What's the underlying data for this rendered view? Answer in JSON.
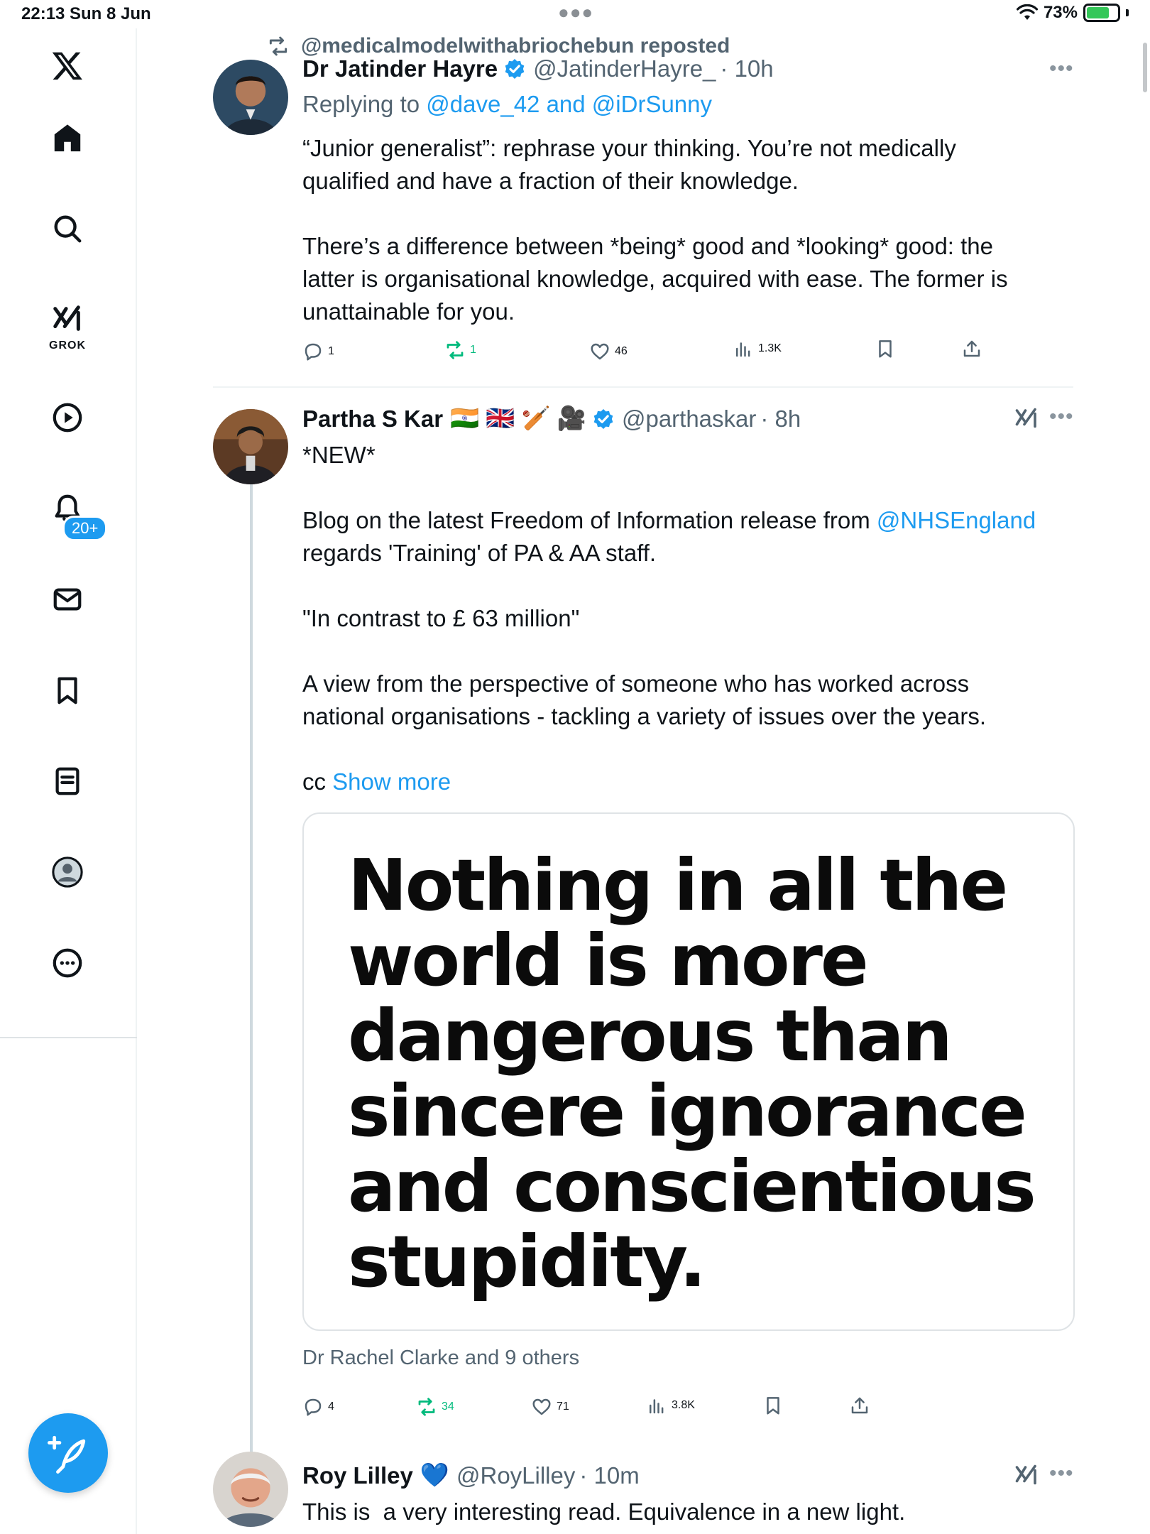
{
  "status_bar": {
    "time": "22:13",
    "date": "Sun 8 Jun",
    "battery": "73%",
    "battery_fraction": 0.73
  },
  "sidebar": {
    "items": [
      "x-logo",
      "home",
      "search",
      "grok",
      "videos",
      "notifications",
      "messages",
      "bookmarks",
      "lists",
      "profile",
      "more"
    ],
    "grok_label": "GROK",
    "notifications_badge": "20+"
  },
  "feed": {
    "repost_notice": "@medicalmodelwithabriochebun reposted",
    "tweets": [
      {
        "name": "Dr Jatinder Hayre",
        "handle": "@JatinderHayre_",
        "time": "· 10h",
        "replying_prefix": "Replying to",
        "replying_users": "@dave_42 and @iDrSunny",
        "paragraphs": [
          "“Junior generalist”: rephrase your thinking. You’re not medically qualified and have a fraction of their knowledge.",
          "There’s a difference between *being* good and *looking* good: the latter is organisational knowledge, acquired with ease. The former is unattainable for you."
        ],
        "stats": {
          "replies": "1",
          "reposts": "1",
          "likes": "46",
          "views": "1.3K"
        }
      },
      {
        "name": "Partha S Kar",
        "flags": "🇮🇳 🇬🇧 🏏 🎥",
        "handle": "@parthaskar",
        "time": "· 8h",
        "p1": "*NEW*",
        "p2_before": "Blog on the latest Freedom of Information release from ",
        "p2_mention": "@NHSEngland",
        "p2_after": " regards 'Training' of PA & AA staff.",
        "p3": "\"In contrast to £ 63 million\"",
        "p4": "A view from the perspective of someone who has worked across national organisations - tackling a variety of issues over the years.",
        "p5_prefix": "cc ",
        "show_more": "Show more",
        "media_quote": "Nothing in all the world is more dangerous than sincere ignorance and conscientious stupidity.",
        "liked_by": "Dr Rachel Clarke and 9 others",
        "stats": {
          "replies": "4",
          "reposts": "34",
          "likes": "71",
          "views": "3.8K"
        }
      },
      {
        "name": "Roy Lilley",
        "name_emoji": "💙",
        "handle": "@RoyLilley",
        "time": "· 10m",
        "text": "This is  a very interesting read. Equivalence in a new light."
      }
    ]
  },
  "colors": {
    "accent": "#1d9bf0",
    "repost_green": "#00ba7c",
    "muted": "#536471",
    "text": "#0f1419"
  }
}
